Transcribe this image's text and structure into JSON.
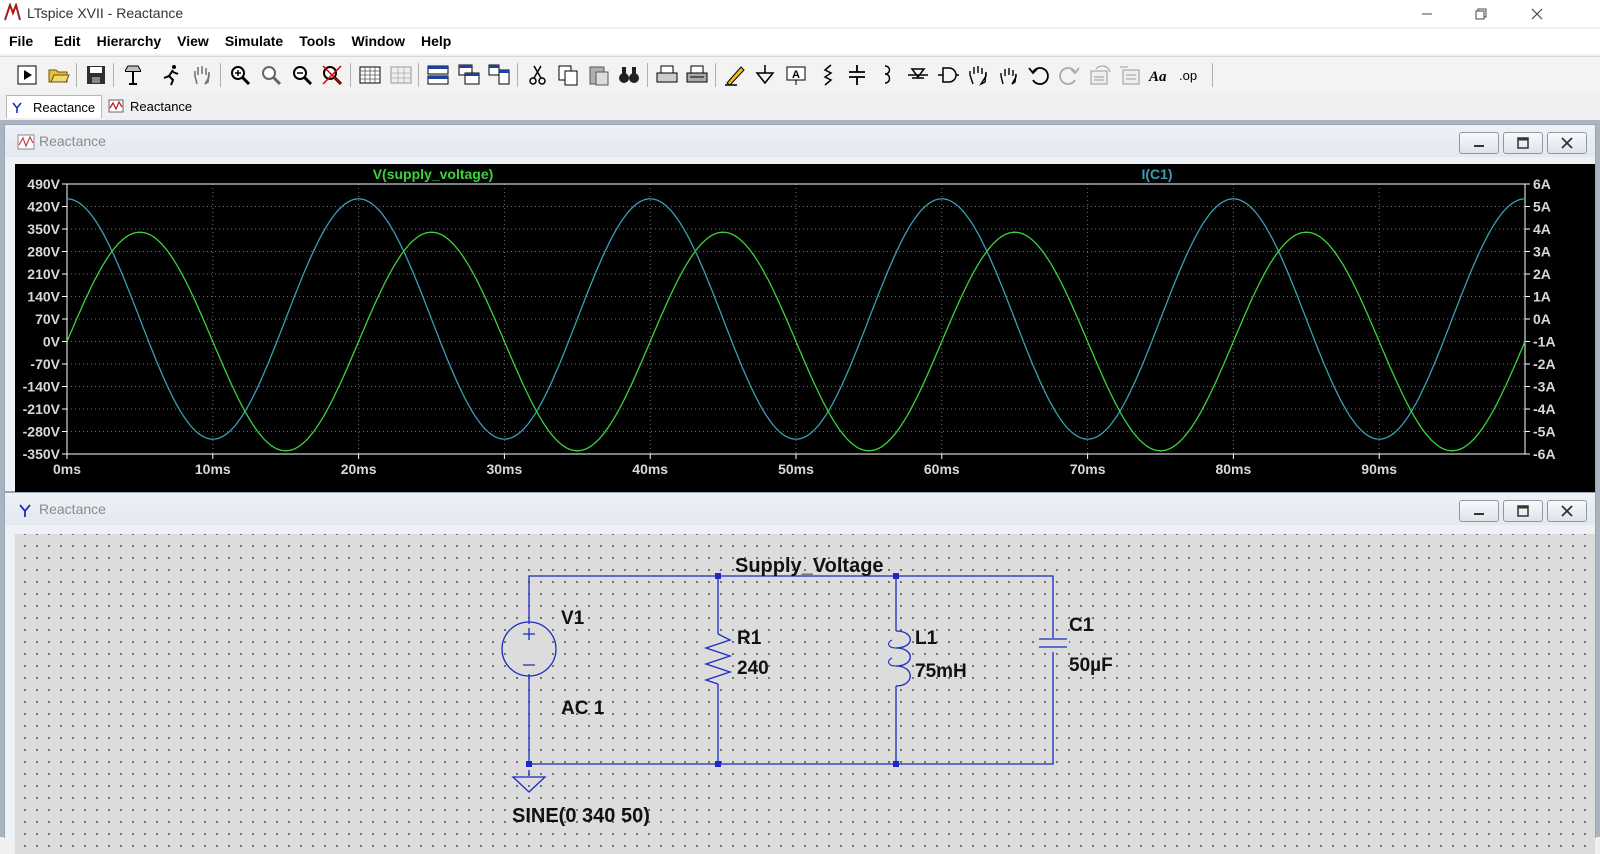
{
  "app": {
    "title": "LTspice XVII - Reactance"
  },
  "menu": [
    "File",
    "Edit",
    "Hierarchy",
    "View",
    "Simulate",
    "Tools",
    "Window",
    "Help"
  ],
  "toolbar": {
    "icons": [
      "run-icon",
      "open-icon",
      "save-icon",
      "control-panel-icon",
      "halt-icon",
      "pan-hand-icon",
      "zoom-in-icon",
      "zoom-box-icon",
      "zoom-out-icon",
      "zoom-cancel-icon",
      "autorange-icon",
      "grid-icon",
      "tile-horizontal-icon",
      "cascade-icon",
      "tile-vertical-icon",
      "cut-icon",
      "copy-icon",
      "paste-icon",
      "find-icon",
      "print-icon",
      "print-setup-icon",
      "draw-wire-icon",
      "ground-icon",
      "label-net-icon",
      "resistor-icon",
      "capacitor-icon",
      "inductor-icon",
      "diode-icon",
      "component-icon",
      "move-icon",
      "drag-icon",
      "undo-icon",
      "redo-icon",
      "rotate-icon",
      "mirror-icon",
      "text-icon",
      "spice-directive-icon"
    ],
    "text_icon_label": "Aa",
    "directive_icon_label": ".op"
  },
  "tabs": [
    {
      "label": "Reactance",
      "icon": "schematic-icon",
      "active": true
    },
    {
      "label": "Reactance",
      "icon": "waveform-icon",
      "active": false
    }
  ],
  "plot_window": {
    "title": "Reactance",
    "trace_v_label": "V(supply_voltage)",
    "trace_i_label": "I(C1)",
    "colors": {
      "background": "#000000",
      "voltage": "#3cd33c",
      "current": "#3a9fb4",
      "grid": "#6e6e6e",
      "axis_text": "#ffffff"
    }
  },
  "chart_data": {
    "type": "line",
    "x_unit": "ms",
    "xlim": [
      0,
      100
    ],
    "x_ticks": [
      "0ms",
      "10ms",
      "20ms",
      "30ms",
      "40ms",
      "50ms",
      "60ms",
      "70ms",
      "80ms",
      "90ms"
    ],
    "y_left_ticks": [
      "490V",
      "420V",
      "350V",
      "280V",
      "210V",
      "140V",
      "70V",
      "0V",
      "-70V",
      "-140V",
      "-210V",
      "-280V",
      "-350V"
    ],
    "y_left_lim": [
      -350,
      490
    ],
    "y_right_ticks": [
      "6A",
      "5A",
      "4A",
      "3A",
      "2A",
      "1A",
      "0A",
      "-1A",
      "-2A",
      "-3A",
      "-4A",
      "-5A",
      "-6A"
    ],
    "y_right_lim": [
      -6,
      6
    ],
    "grid": true,
    "series": [
      {
        "name": "V(supply_voltage)",
        "axis": "left",
        "shape": "sine",
        "amplitude": 340,
        "frequency_hz": 50,
        "phase_deg": 0,
        "color": "#3cd33c"
      },
      {
        "name": "I(C1)",
        "axis": "right",
        "shape": "sine",
        "amplitude": 5.34,
        "frequency_hz": 50,
        "phase_deg": 90,
        "color": "#3a9fb4"
      }
    ]
  },
  "schematic_window": {
    "title": "Reactance",
    "net_label": "Supply_Voltage",
    "components": {
      "v1": {
        "name": "V1",
        "value": "AC 1",
        "source": "SINE(0 340 50)"
      },
      "r1": {
        "name": "R1",
        "value": "240"
      },
      "l1": {
        "name": "L1",
        "value": "75mH"
      },
      "c1": {
        "name": "C1",
        "value": "50µF"
      }
    },
    "colors": {
      "wire": "#1a2bc0",
      "background": "#dcdcdc"
    }
  }
}
